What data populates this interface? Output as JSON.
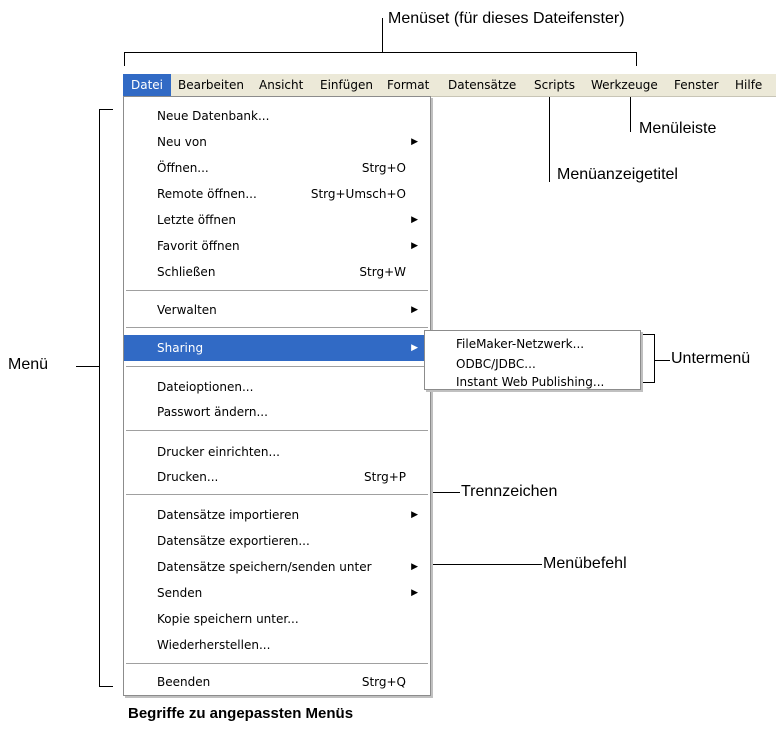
{
  "callouts": {
    "menueset": "Menüset (für dieses Dateifenster)",
    "menueleiste": "Menüleiste",
    "menueanzeigetitel": "Menüanzeigetitel",
    "untermenue": "Untermenü",
    "menue": "Menü",
    "trennzeichen": "Trennzeichen",
    "menuebefehl": "Menübefehl"
  },
  "caption": "Begriffe zu angepassten Menüs",
  "menubar": {
    "items": [
      "Datei",
      "Bearbeiten",
      "Ansicht",
      "Einfügen",
      "Format",
      "Datensätze",
      "Scripts",
      "Werkzeuge",
      "Fenster",
      "Hilfe"
    ],
    "selected": "Datei"
  },
  "file_menu": {
    "items": [
      {
        "label": "Neue Datenbank...",
        "shortcut": "",
        "submenu": false
      },
      {
        "label": "Neu von",
        "shortcut": "",
        "submenu": true
      },
      {
        "label": "Öffnen...",
        "shortcut": "Strg+O",
        "submenu": false
      },
      {
        "label": "Remote öffnen...",
        "shortcut": "Strg+Umsch+O",
        "submenu": false
      },
      {
        "label": "Letzte öffnen",
        "shortcut": "",
        "submenu": true
      },
      {
        "label": "Favorit öffnen",
        "shortcut": "",
        "submenu": true
      },
      {
        "label": "Schließen",
        "shortcut": "Strg+W",
        "submenu": false
      },
      {
        "label": "Verwalten",
        "shortcut": "",
        "submenu": true
      },
      {
        "label": "Sharing",
        "shortcut": "",
        "submenu": true,
        "highlighted": true
      },
      {
        "label": "Dateioptionen...",
        "shortcut": "",
        "submenu": false
      },
      {
        "label": "Passwort ändern...",
        "shortcut": "",
        "submenu": false
      },
      {
        "label": "Drucker einrichten...",
        "shortcut": "",
        "submenu": false
      },
      {
        "label": "Drucken...",
        "shortcut": "Strg+P",
        "submenu": false
      },
      {
        "label": "Datensätze importieren",
        "shortcut": "",
        "submenu": true
      },
      {
        "label": "Datensätze exportieren...",
        "shortcut": "",
        "submenu": false
      },
      {
        "label": "Datensätze speichern/senden unter",
        "shortcut": "",
        "submenu": true
      },
      {
        "label": "Senden",
        "shortcut": "",
        "submenu": true
      },
      {
        "label": "Kopie speichern unter...",
        "shortcut": "",
        "submenu": false
      },
      {
        "label": "Wiederherstellen...",
        "shortcut": "",
        "submenu": false
      },
      {
        "label": "Beenden",
        "shortcut": "Strg+Q",
        "submenu": false
      }
    ],
    "submenu_arrow": "▶"
  },
  "sharing_submenu": {
    "items": [
      "FileMaker-Netzwerk...",
      "ODBC/JDBC...",
      "Instant Web Publishing..."
    ]
  },
  "colors": {
    "highlight": "#316ac5",
    "menubar": "#ece9d8"
  }
}
